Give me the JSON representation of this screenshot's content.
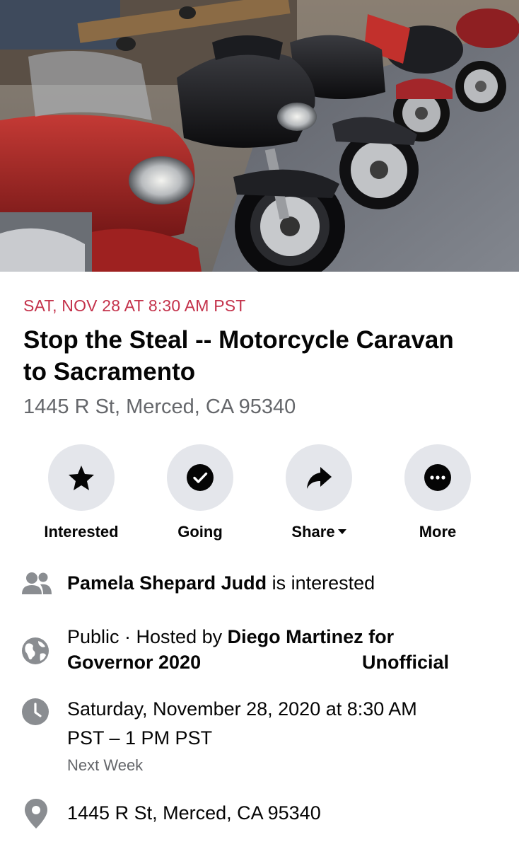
{
  "event": {
    "date_line": "SAT, NOV 28 AT 8:30 AM PST",
    "title": "Stop the Steal -- Motorcycle Caravan to Sacramento",
    "address": "1445 R St, Merced, CA 95340"
  },
  "colors": {
    "date_accent": "#c4324b",
    "button_bg": "#e4e6eb",
    "secondary_text": "#65676b",
    "icon_gray": "#8a8d91"
  },
  "actions": [
    {
      "label": "Interested",
      "icon": "star-icon"
    },
    {
      "label": "Going",
      "icon": "check-circle-icon"
    },
    {
      "label": "Share",
      "icon": "share-arrow-icon"
    },
    {
      "label": "More",
      "icon": "more-dots-icon"
    }
  ],
  "details": {
    "interest": {
      "icon": "people-icon",
      "name": "Pamela Shepard Judd",
      "suffix": " is interested"
    },
    "host": {
      "icon": "globe-icon",
      "prefix": "Public · Hosted by ",
      "host_name": "Diego Martinez for Governor 2020",
      "tag": "Unofficial"
    },
    "time": {
      "icon": "clock-icon",
      "line1": "Saturday, November 28, 2020 at 8:30 AM",
      "line2": "PST – 1 PM PST",
      "relative": "Next Week"
    },
    "location": {
      "icon": "location-pin-icon",
      "text": "1445 R St, Merced, CA 95340"
    }
  }
}
